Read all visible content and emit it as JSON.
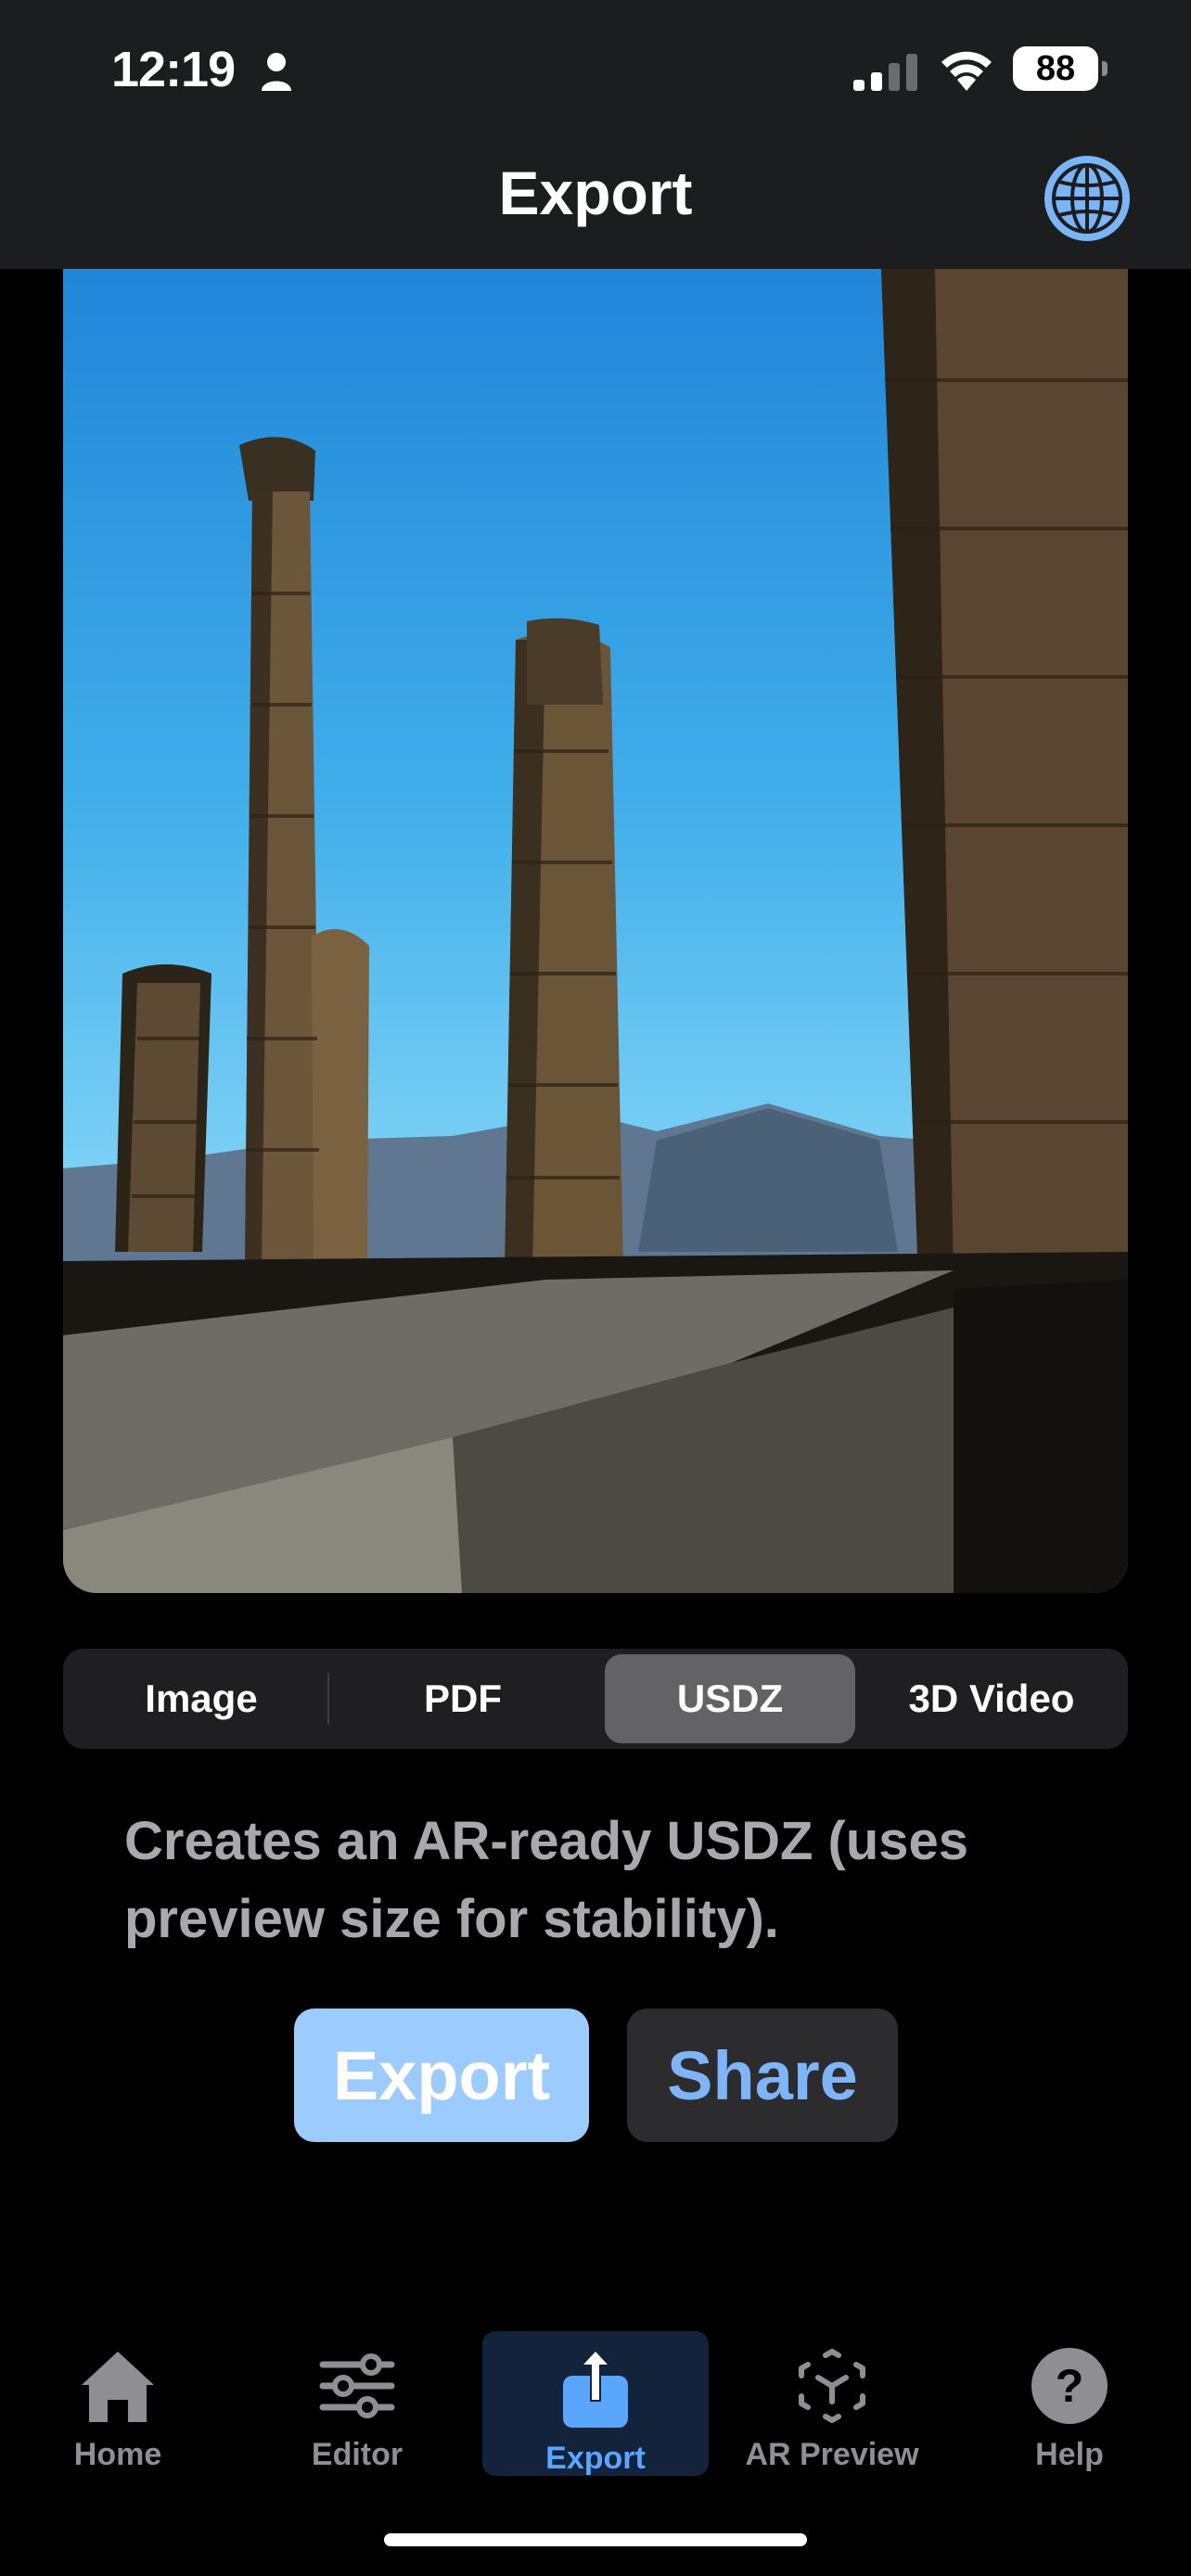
{
  "status_bar": {
    "time": "12:19",
    "battery": "88",
    "icons": [
      "person-icon",
      "cellular-signal-icon",
      "wifi-icon",
      "battery-icon"
    ]
  },
  "nav": {
    "title": "Export",
    "right_icon": "globe-icon"
  },
  "photo": {
    "subject": "ancient columns photo"
  },
  "format_picker": {
    "options": [
      "Image",
      "PDF",
      "USDZ",
      "3D Video"
    ],
    "selected": "USDZ"
  },
  "description": "Creates an AR-ready USDZ (uses preview size for stability).",
  "actions": {
    "export_label": "Export",
    "share_label": "Share"
  },
  "tab_bar": {
    "items": [
      {
        "label": "Home",
        "icon": "house-icon"
      },
      {
        "label": "Editor",
        "icon": "sliders-icon"
      },
      {
        "label": "Export",
        "icon": "share-icon"
      },
      {
        "label": "AR Preview",
        "icon": "ar-cube-icon"
      },
      {
        "label": "Help",
        "icon": "question-icon"
      }
    ],
    "selected": "Export"
  },
  "colors": {
    "accent": "#5aa5ff",
    "export_button": "#9ccbff",
    "share_text": "#7db5f8",
    "bar_background": "#1c1d1f"
  }
}
